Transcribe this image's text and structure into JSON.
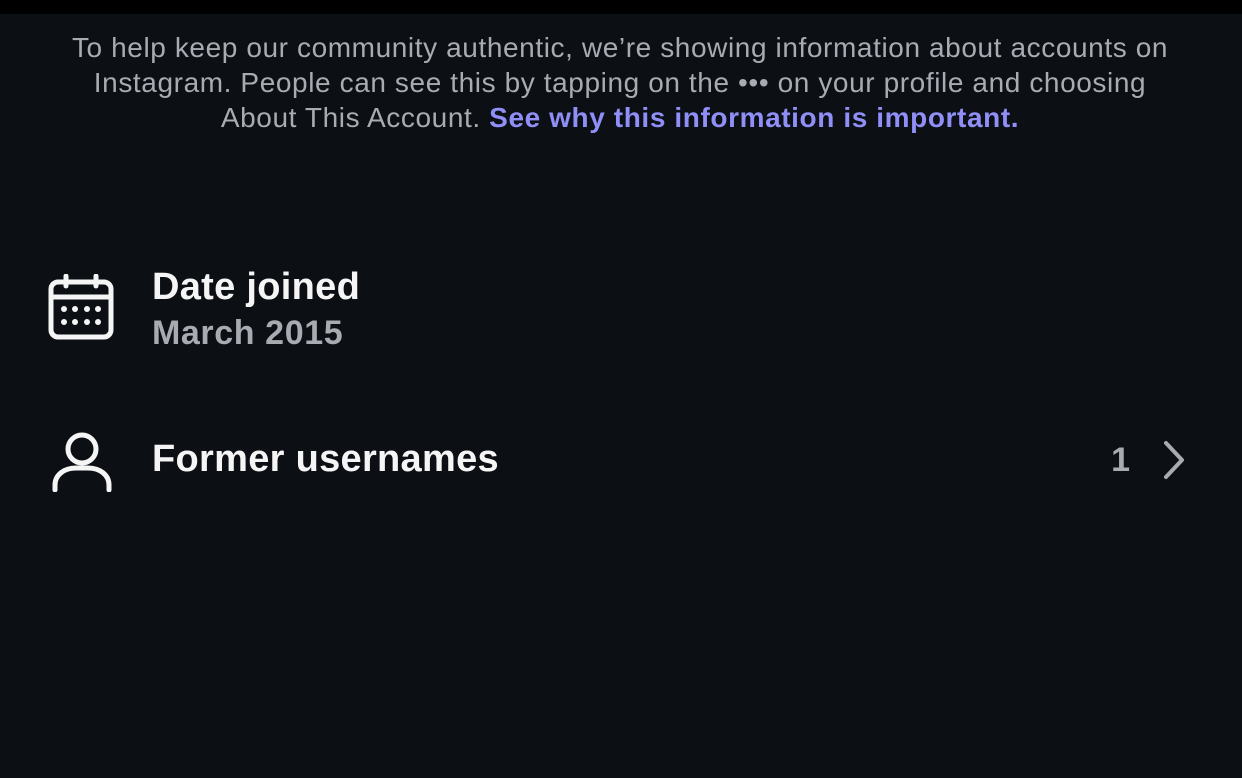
{
  "intro": {
    "text": "To help keep our community authentic, we’re showing information about accounts on Instagram. People can see this by tapping on the ••• on your profile and choosing About This Account.",
    "link_text": "See why this information is important."
  },
  "date_joined": {
    "icon": "calendar-icon",
    "title": "Date joined",
    "value": "March 2015"
  },
  "former_usernames": {
    "icon": "person-icon",
    "title": "Former usernames",
    "count": "1",
    "chevron_icon": "chevron-right-icon"
  },
  "colors": {
    "background": "#0c0f14",
    "primary_text": "#f5f5f5",
    "secondary_text": "#a8abb2",
    "link": "#8f8ff7"
  }
}
